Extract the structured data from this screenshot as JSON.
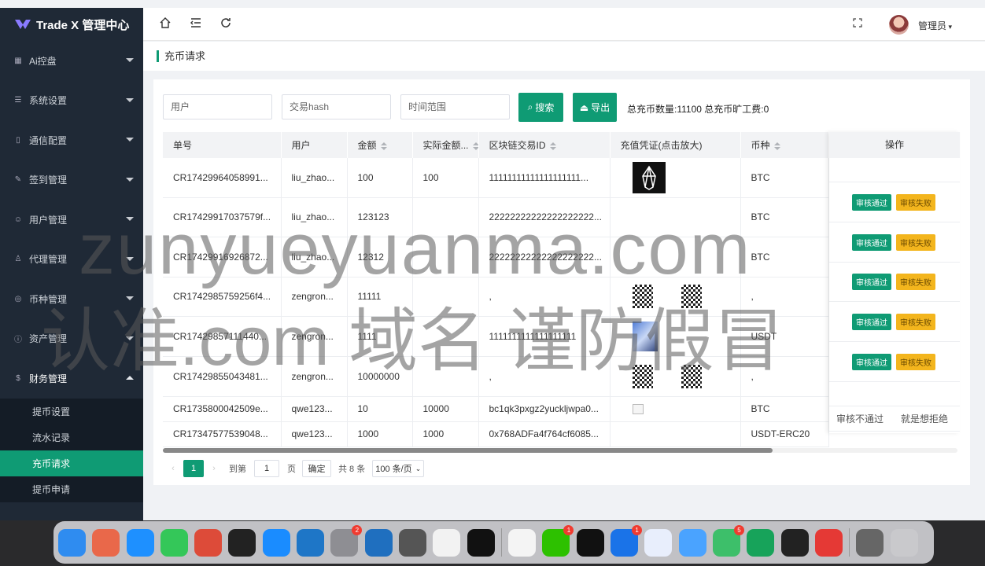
{
  "app": {
    "title": "Trade X 管理中心"
  },
  "sidebar": {
    "items": [
      {
        "label": "Ai控盘",
        "icon": "grid-icon"
      },
      {
        "label": "系统设置",
        "icon": "sliders-icon"
      },
      {
        "label": "通信配置",
        "icon": "phone-icon"
      },
      {
        "label": "签到管理",
        "icon": "edit-icon"
      },
      {
        "label": "用户管理",
        "icon": "users-icon"
      },
      {
        "label": "代理管理",
        "icon": "user-icon"
      },
      {
        "label": "币种管理",
        "icon": "coins-icon"
      },
      {
        "label": "资产管理",
        "icon": "info-icon"
      },
      {
        "label": "财务管理",
        "icon": "money-icon"
      }
    ],
    "sub_items": [
      "提币设置",
      "流水记录",
      "充币请求",
      "提币申请"
    ],
    "active_sub": "充币请求"
  },
  "topbar": {
    "user": "管理员"
  },
  "tab": {
    "title": "充币请求"
  },
  "filters": {
    "user_placeholder": "用户",
    "hash_placeholder": "交易hash",
    "time_placeholder": "时间范围",
    "search_label": "搜索",
    "export_label": "导出",
    "summary": "总充币数量:11100 总充币旷工费:0"
  },
  "table": {
    "headers": [
      "单号",
      "用户",
      "金额",
      "实际金额...",
      "区块链交易ID",
      "充值凭证(点击放大)",
      "币种",
      "操作"
    ],
    "rows": [
      {
        "id": "CR17429964058991...",
        "user": "liu_zhao...",
        "amount": "100",
        "actual": "100",
        "txid": "11111111111111111111...",
        "coin": "BTC",
        "proof": "eos"
      },
      {
        "id": "CR17429917037579f...",
        "user": "liu_zhao...",
        "amount": "123123",
        "actual": "",
        "txid": "22222222222222222222...",
        "coin": "BTC",
        "proof": ""
      },
      {
        "id": "CR174299169268​72...",
        "user": "liu_zhao...",
        "amount": "12312",
        "actual": "",
        "txid": "22222222222222222222...",
        "coin": "BTC",
        "proof": ""
      },
      {
        "id": "CR17429857592​56f4...",
        "user": "zengron...",
        "amount": "11111",
        "actual": "",
        "txid": ",",
        "coin": ",",
        "proof": "qr"
      },
      {
        "id": "CR174298571114​40...",
        "user": "zengron...",
        "amount": "1111",
        "actual": "",
        "txid": "1111111111111111111",
        "coin": "USDT",
        "proof": "photo"
      },
      {
        "id": "CR17429855043481...",
        "user": "zengron...",
        "amount": "10000000",
        "actual": "",
        "txid": ",",
        "coin": ",",
        "proof": "qr"
      },
      {
        "id": "CR1735800042509e...",
        "user": "qwe123...",
        "amount": "10",
        "actual": "10000",
        "txid": "bc1qk3pxgz2yuckljwpa0...",
        "coin": "BTC",
        "proof": "broken"
      },
      {
        "id": "CR17347577539048...",
        "user": "qwe123...",
        "amount": "1000",
        "actual": "1000",
        "txid": "0x768ADFa4f764cf6085...",
        "coin": "USDT-ERC20",
        "proof": ""
      }
    ],
    "actions": {
      "approve": "审核通过",
      "reject": "审核失败"
    },
    "last_row_status": [
      "审核不通过",
      "就是想拒绝"
    ]
  },
  "pager": {
    "current": "1",
    "goto_label": "到第",
    "goto_value": "1",
    "page_label": "页",
    "confirm": "确定",
    "total": "共 8 条",
    "page_size": "100 条/页"
  },
  "watermark": {
    "line1": "zunyueyuanma.com",
    "line2": "认准.com 域名 谨防假冒"
  },
  "dock": {
    "apps": [
      {
        "name": "finder-icon",
        "color": "#2f8cf0"
      },
      {
        "name": "launchpad-icon",
        "color": "#e9684a"
      },
      {
        "name": "safari-icon",
        "color": "#1e90ff"
      },
      {
        "name": "messages-icon",
        "color": "#34c759"
      },
      {
        "name": "chrome-icon",
        "color": "#dd4b39"
      },
      {
        "name": "terminal-icon",
        "color": "#222222"
      },
      {
        "name": "appstore-icon",
        "color": "#1a8cff"
      },
      {
        "name": "edge-icon",
        "color": "#1e76c7"
      },
      {
        "name": "settings-icon",
        "color": "#8e8e93",
        "badge": "2"
      },
      {
        "name": "vscode-icon",
        "color": "#1f6fbf"
      },
      {
        "name": "iphone-mirroring-icon",
        "color": "#555555"
      },
      {
        "name": "chatgpt-icon",
        "color": "#f2f2f2"
      },
      {
        "name": "intellij-icon",
        "color": "#111111"
      },
      {
        "name": "textedit-icon",
        "color": "#f4f4f4"
      },
      {
        "name": "wechat-icon",
        "color": "#2dc100",
        "badge": "1"
      },
      {
        "name": "music-app-icon",
        "color": "#111111"
      },
      {
        "name": "mail-app-icon",
        "color": "#1a73e8",
        "badge": "1"
      },
      {
        "name": "rocket-icon",
        "color": "#e8eefc"
      },
      {
        "name": "maps-icon",
        "color": "#4aa3ff"
      },
      {
        "name": "chat-bubble-icon",
        "color": "#3dbf6a",
        "badge": "5"
      },
      {
        "name": "excel-icon",
        "color": "#17a35a"
      },
      {
        "name": "box-icon",
        "color": "#222222"
      },
      {
        "name": "wps-icon",
        "color": "#e53935"
      },
      {
        "name": "phone-mirror-icon",
        "color": "#666666"
      },
      {
        "name": "trash-icon",
        "color": "#c9c9cc"
      }
    ]
  }
}
